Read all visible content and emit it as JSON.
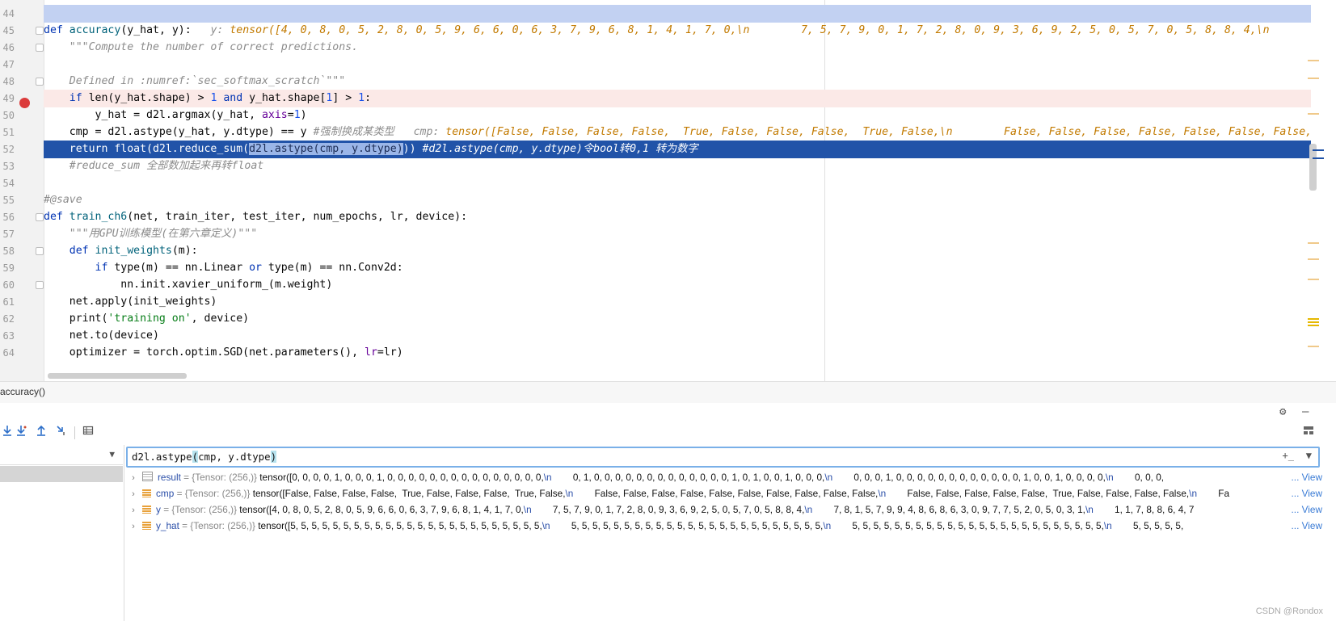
{
  "editor": {
    "line_numbers": [
      "44",
      "45",
      "46",
      "47",
      "48",
      "49",
      "50",
      "51",
      "52",
      "53",
      "54",
      "55",
      "56",
      "57",
      "58",
      "59",
      "60",
      "61",
      "62",
      "63",
      "64"
    ],
    "l45": {
      "kw": "def",
      "fname": "accuracy",
      "sig": "(y_hat, y):",
      "hint_name": "y:",
      "hint_value": "tensor([4, 0, 8, 0, 5, 2, 8, 0, 5, 9, 6, 6, 0, 6, 3, 7, 9, 6, 8, 1, 4, 1, 7, 0,\\n        7, 5, 7, 9, 0, 1, 7, 2, 8, 0, 9, 3, 6, 9, 2, 5, 0, 5, 7, 0, 5, 8, 8, 4,\\n"
    },
    "l46": "\"\"\"Compute the number of correct predictions.",
    "l48": "Defined in :numref:`sec_softmax_scratch`\"\"\"",
    "l49": {
      "kw_if": "if",
      "p1": " len(y_hat.shape) > ",
      "n1": "1",
      "kw_and": " and ",
      "p2": "y_hat.shape[",
      "n2": "1",
      "p3": "] > ",
      "n3": "1",
      "p4": ":"
    },
    "l50": {
      "p1": "y_hat = d2l.argmax(y_hat, ",
      "named": "axis",
      "p2": "=",
      "n": "1",
      "p3": ")"
    },
    "l51": {
      "code": "cmp = d2l.astype(y_hat, y.dtype) == y ",
      "comment": "#强制换成某类型",
      "hint_name": "cmp:",
      "hint_value": "tensor([False, False, False, False,  True, False, False, False,  True, False,\\n        False, False, False, False, False, False, False, False, False, False,"
    },
    "l52": {
      "p1": "return float(d2l.reduce_sum(",
      "sel": "d2l.astype(cmp, y.dtype)",
      "p2": ")) ",
      "comment": "#d2l.astype(cmp, y.dtype)令bool转0,1 转为数字"
    },
    "l53": "#reduce_sum 全部数加起来再转float",
    "l55": "#@save",
    "l56": {
      "kw": "def",
      "fname": "train_ch6",
      "sig": "(net, train_iter, test_iter, num_epochs, lr, device):"
    },
    "l57": "\"\"\"用GPU训练模型(在第六章定义)\"\"\"",
    "l58": {
      "kw": "def",
      "fname": "init_weights",
      "sig": "(m):"
    },
    "l59": {
      "kw_if": "if",
      "p1": " type(m) == nn.Linear ",
      "kw_or": "or",
      "p2": " type(m) == nn.Conv2d:"
    },
    "l60": "nn.init.xavier_uniform_(m.weight)",
    "l61": "net.apply(init_weights)",
    "l62": {
      "p1": "print(",
      "str": "'training on'",
      "p2": ", device)"
    },
    "l63": "net.to(device)",
    "l64": {
      "p1": "optimizer = torch.optim.SGD(net.parameters(), ",
      "named": "lr",
      "p2": "=lr)"
    }
  },
  "breadcrumb": "accuracy()",
  "evaluate": {
    "a": "d2l.astype",
    "paren_open": "(",
    "b": "cmp, y.dtype",
    "paren_close": ")"
  },
  "variables": [
    {
      "name": "result",
      "type": "= {Tensor: (256,)}",
      "value": "tensor([0, 0, 0, 0, 1, 0, 0, 0, 1, 0, 0, 0, 0, 0, 0, 0, 0, 0, 0, 0, 0, 0, 0, 0,",
      "e1": "\\n",
      "v2": "        0, 1, 0, 0, 0, 0, 0, 0, 0, 0, 0, 0, 0, 0, 0, 1, 0, 1, 0, 0, 1, 0, 0, 0,",
      "e2": "\\n",
      "v3": "        0, 0, 0, 1, 0, 0, 0, 0, 0, 0, 0, 0, 0, 0, 0, 0, 1, 0, 0, 1, 0, 0, 0, 0,",
      "e3": "\\n",
      "v4": "        0, 0, 0,",
      "view": "... View"
    },
    {
      "name": "cmp",
      "type": "= {Tensor: (256,)}",
      "value": "tensor([False, False, False, False,  True, False, False, False,  True, False,",
      "e1": "\\n",
      "v2": "        False, False, False, False, False, False, False, False, False, False,",
      "e2": "\\n",
      "v3": "        False, False, False, False, False,  True, False, False, False, False,",
      "e3": "\\n",
      "v4": "        Fa",
      "view": "... View"
    },
    {
      "name": "y",
      "type": "= {Tensor: (256,)}",
      "value": "tensor([4, 0, 8, 0, 5, 2, 8, 0, 5, 9, 6, 6, 0, 6, 3, 7, 9, 6, 8, 1, 4, 1, 7, 0,",
      "e1": "\\n",
      "v2": "        7, 5, 7, 9, 0, 1, 7, 2, 8, 0, 9, 3, 6, 9, 2, 5, 0, 5, 7, 0, 5, 8, 8, 4,",
      "e2": "\\n",
      "v3": "        7, 8, 1, 5, 7, 9, 9, 4, 8, 6, 8, 6, 3, 0, 9, 7, 7, 5, 2, 0, 5, 0, 3, 1,",
      "e3": "\\n",
      "v4": "        1, 1, 7, 8, 8, 6, 4, 7",
      "view": "... View"
    },
    {
      "name": "y_hat",
      "type": "= {Tensor: (256,)}",
      "value": "tensor([5, 5, 5, 5, 5, 5, 5, 5, 5, 5, 5, 5, 5, 5, 5, 5, 5, 5, 5, 5, 5, 5, 5, 5,",
      "e1": "\\n",
      "v2": "        5, 5, 5, 5, 5, 5, 5, 5, 5, 5, 5, 5, 5, 5, 5, 5, 5, 5, 5, 5, 5, 5, 5, 5,",
      "e2": "\\n",
      "v3": "        5, 5, 5, 5, 5, 5, 5, 5, 5, 5, 5, 5, 5, 5, 5, 5, 5, 5, 5, 5, 5, 5, 5, 5,",
      "e3": "\\n",
      "v4": "        5, 5, 5, 5, 5,",
      "view": "... View"
    }
  ],
  "watermark": "CSDN @Rondox",
  "icons": {
    "settings": "gear-icon",
    "minimize": "minimize-icon",
    "layout": "layout-icon",
    "step_into": "step-into-icon",
    "step_into_mine": "step-into-my-code-icon",
    "step_out": "step-out-icon",
    "run_to_cursor": "run-to-cursor-icon",
    "evaluate": "table-icon"
  }
}
